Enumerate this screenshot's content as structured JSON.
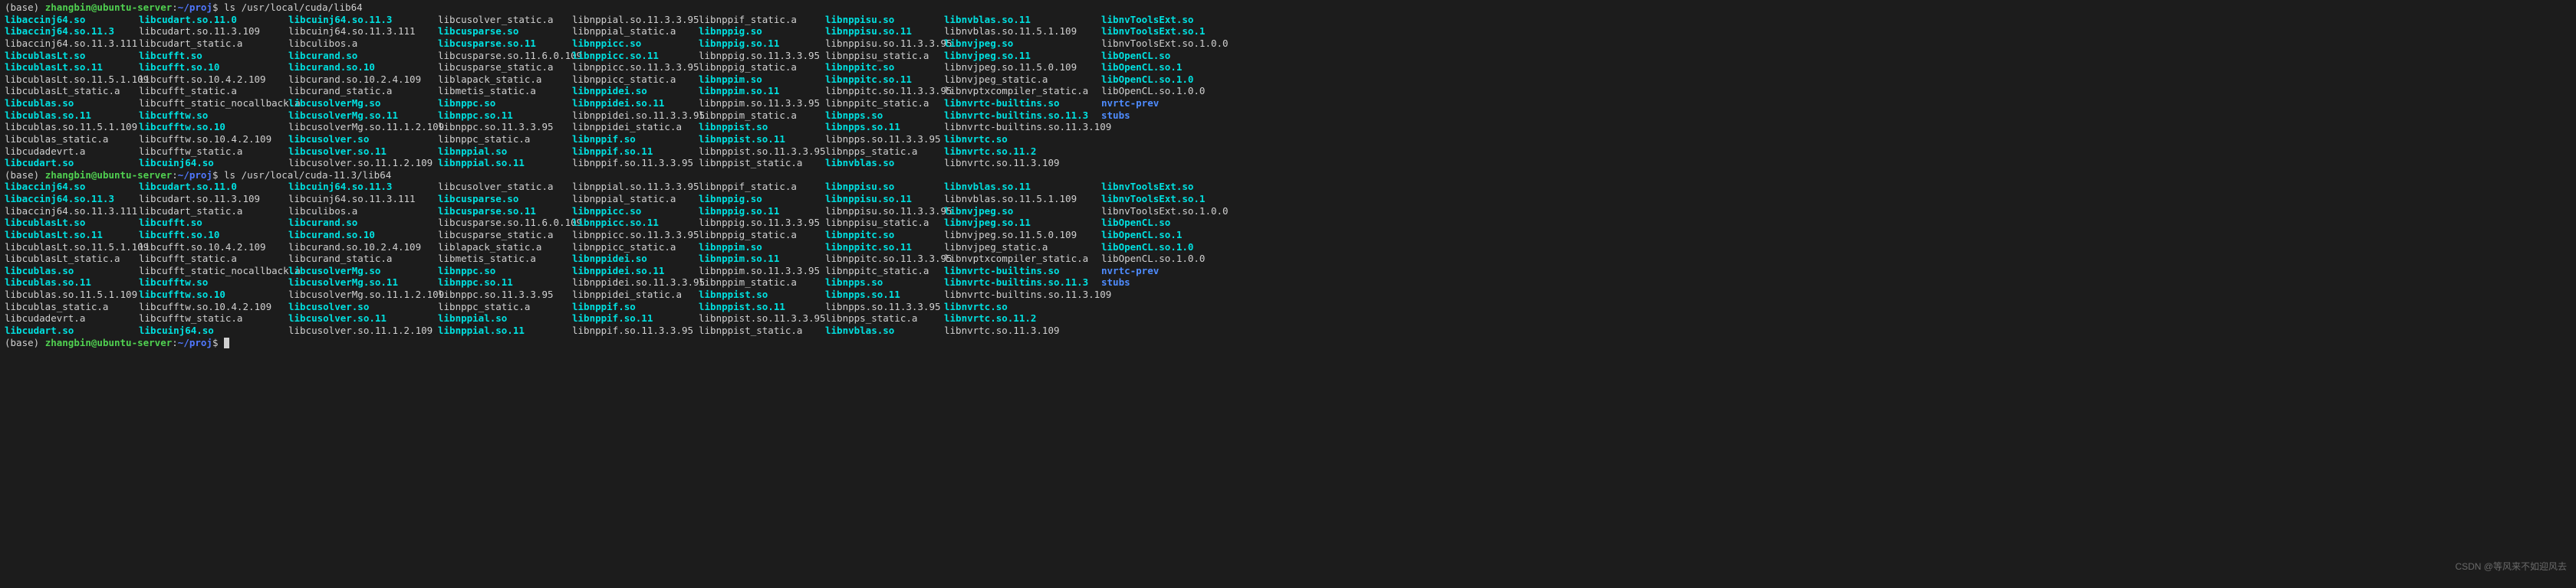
{
  "prompt": {
    "env": "(base)",
    "user_host": "zhangbin@ubuntu-server",
    "sep1": ":",
    "path": "~/proj",
    "sep2": "$ "
  },
  "cmd1": "ls /usr/local/cuda/lib64",
  "cmd2": "ls /usr/local/cuda-11.3/lib64",
  "listing": {
    "cols": [
      [
        {
          "n": "libaccinj64.so",
          "t": "link"
        },
        {
          "n": "libaccinj64.so.11.3",
          "t": "link"
        },
        {
          "n": "libaccinj64.so.11.3.111",
          "t": "reg"
        },
        {
          "n": "libcublasLt.so",
          "t": "link"
        },
        {
          "n": "libcublasLt.so.11",
          "t": "link"
        },
        {
          "n": "libcublasLt.so.11.5.1.109",
          "t": "reg"
        },
        {
          "n": "libcublasLt_static.a",
          "t": "reg"
        },
        {
          "n": "libcublas.so",
          "t": "link"
        },
        {
          "n": "libcublas.so.11",
          "t": "link"
        },
        {
          "n": "libcublas.so.11.5.1.109",
          "t": "reg"
        },
        {
          "n": "libcublas_static.a",
          "t": "reg"
        },
        {
          "n": "libcudadevrt.a",
          "t": "reg"
        },
        {
          "n": "libcudart.so",
          "t": "link"
        }
      ],
      [
        {
          "n": "libcudart.so.11.0",
          "t": "link"
        },
        {
          "n": "libcudart.so.11.3.109",
          "t": "reg"
        },
        {
          "n": "libcudart_static.a",
          "t": "reg"
        },
        {
          "n": "libcufft.so",
          "t": "link"
        },
        {
          "n": "libcufft.so.10",
          "t": "link"
        },
        {
          "n": "libcufft.so.10.4.2.109",
          "t": "reg"
        },
        {
          "n": "libcufft_static.a",
          "t": "reg"
        },
        {
          "n": "libcufft_static_nocallback.a",
          "t": "reg"
        },
        {
          "n": "libcufftw.so",
          "t": "link"
        },
        {
          "n": "libcufftw.so.10",
          "t": "link"
        },
        {
          "n": "libcufftw.so.10.4.2.109",
          "t": "reg"
        },
        {
          "n": "libcufftw_static.a",
          "t": "reg"
        },
        {
          "n": "libcuinj64.so",
          "t": "link"
        }
      ],
      [
        {
          "n": "libcuinj64.so.11.3",
          "t": "link"
        },
        {
          "n": "libcuinj64.so.11.3.111",
          "t": "reg"
        },
        {
          "n": "libculibos.a",
          "t": "reg"
        },
        {
          "n": "libcurand.so",
          "t": "link"
        },
        {
          "n": "libcurand.so.10",
          "t": "link"
        },
        {
          "n": "libcurand.so.10.2.4.109",
          "t": "reg"
        },
        {
          "n": "libcurand_static.a",
          "t": "reg"
        },
        {
          "n": "libcusolverMg.so",
          "t": "link"
        },
        {
          "n": "libcusolverMg.so.11",
          "t": "link"
        },
        {
          "n": "libcusolverMg.so.11.1.2.109",
          "t": "reg"
        },
        {
          "n": "libcusolver.so",
          "t": "link"
        },
        {
          "n": "libcusolver.so.11",
          "t": "link"
        },
        {
          "n": "libcusolver.so.11.1.2.109",
          "t": "reg"
        }
      ],
      [
        {
          "n": "libcusolver_static.a",
          "t": "reg"
        },
        {
          "n": "libcusparse.so",
          "t": "link"
        },
        {
          "n": "libcusparse.so.11",
          "t": "link"
        },
        {
          "n": "libcusparse.so.11.6.0.109",
          "t": "reg"
        },
        {
          "n": "libcusparse_static.a",
          "t": "reg"
        },
        {
          "n": "liblapack_static.a",
          "t": "reg"
        },
        {
          "n": "libmetis_static.a",
          "t": "reg"
        },
        {
          "n": "libnppc.so",
          "t": "link"
        },
        {
          "n": "libnppc.so.11",
          "t": "link"
        },
        {
          "n": "libnppc.so.11.3.3.95",
          "t": "reg"
        },
        {
          "n": "libnppc_static.a",
          "t": "reg"
        },
        {
          "n": "libnppial.so",
          "t": "link"
        },
        {
          "n": "libnppial.so.11",
          "t": "link"
        }
      ],
      [
        {
          "n": "libnppial.so.11.3.3.95",
          "t": "reg"
        },
        {
          "n": "libnppial_static.a",
          "t": "reg"
        },
        {
          "n": "libnppicc.so",
          "t": "link"
        },
        {
          "n": "libnppicc.so.11",
          "t": "link"
        },
        {
          "n": "libnppicc.so.11.3.3.95",
          "t": "reg"
        },
        {
          "n": "libnppicc_static.a",
          "t": "reg"
        },
        {
          "n": "libnppidei.so",
          "t": "link"
        },
        {
          "n": "libnppidei.so.11",
          "t": "link"
        },
        {
          "n": "libnppidei.so.11.3.3.95",
          "t": "reg"
        },
        {
          "n": "libnppidei_static.a",
          "t": "reg"
        },
        {
          "n": "libnppif.so",
          "t": "link"
        },
        {
          "n": "libnppif.so.11",
          "t": "link"
        },
        {
          "n": "libnppif.so.11.3.3.95",
          "t": "reg"
        }
      ],
      [
        {
          "n": "libnppif_static.a",
          "t": "reg"
        },
        {
          "n": "libnppig.so",
          "t": "link"
        },
        {
          "n": "libnppig.so.11",
          "t": "link"
        },
        {
          "n": "libnppig.so.11.3.3.95",
          "t": "reg"
        },
        {
          "n": "libnppig_static.a",
          "t": "reg"
        },
        {
          "n": "libnppim.so",
          "t": "link"
        },
        {
          "n": "libnppim.so.11",
          "t": "link"
        },
        {
          "n": "libnppim.so.11.3.3.95",
          "t": "reg"
        },
        {
          "n": "libnppim_static.a",
          "t": "reg"
        },
        {
          "n": "libnppist.so",
          "t": "link"
        },
        {
          "n": "libnppist.so.11",
          "t": "link"
        },
        {
          "n": "libnppist.so.11.3.3.95",
          "t": "reg"
        },
        {
          "n": "libnppist_static.a",
          "t": "reg"
        }
      ],
      [
        {
          "n": "libnppisu.so",
          "t": "link"
        },
        {
          "n": "libnppisu.so.11",
          "t": "link"
        },
        {
          "n": "libnppisu.so.11.3.3.95",
          "t": "reg"
        },
        {
          "n": "libnppisu_static.a",
          "t": "reg"
        },
        {
          "n": "libnppitc.so",
          "t": "link"
        },
        {
          "n": "libnppitc.so.11",
          "t": "link"
        },
        {
          "n": "libnppitc.so.11.3.3.95",
          "t": "reg"
        },
        {
          "n": "libnppitc_static.a",
          "t": "reg"
        },
        {
          "n": "libnpps.so",
          "t": "link"
        },
        {
          "n": "libnpps.so.11",
          "t": "link"
        },
        {
          "n": "libnpps.so.11.3.3.95",
          "t": "reg"
        },
        {
          "n": "libnpps_static.a",
          "t": "reg"
        },
        {
          "n": "libnvblas.so",
          "t": "link"
        }
      ],
      [
        {
          "n": "libnvblas.so.11",
          "t": "link"
        },
        {
          "n": "libnvblas.so.11.5.1.109",
          "t": "reg"
        },
        {
          "n": "libnvjpeg.so",
          "t": "link"
        },
        {
          "n": "libnvjpeg.so.11",
          "t": "link"
        },
        {
          "n": "libnvjpeg.so.11.5.0.109",
          "t": "reg"
        },
        {
          "n": "libnvjpeg_static.a",
          "t": "reg"
        },
        {
          "n": "libnvptxcompiler_static.a",
          "t": "reg"
        },
        {
          "n": "libnvrtc-builtins.so",
          "t": "link"
        },
        {
          "n": "libnvrtc-builtins.so.11.3",
          "t": "link"
        },
        {
          "n": "libnvrtc-builtins.so.11.3.109",
          "t": "reg"
        },
        {
          "n": "libnvrtc.so",
          "t": "link"
        },
        {
          "n": "libnvrtc.so.11.2",
          "t": "link"
        },
        {
          "n": "libnvrtc.so.11.3.109",
          "t": "reg"
        }
      ],
      [
        {
          "n": "libnvToolsExt.so",
          "t": "link"
        },
        {
          "n": "libnvToolsExt.so.1",
          "t": "link"
        },
        {
          "n": "libnvToolsExt.so.1.0.0",
          "t": "reg"
        },
        {
          "n": "libOpenCL.so",
          "t": "link"
        },
        {
          "n": "libOpenCL.so.1",
          "t": "link"
        },
        {
          "n": "libOpenCL.so.1.0",
          "t": "link"
        },
        {
          "n": "libOpenCL.so.1.0.0",
          "t": "reg"
        },
        {
          "n": "nvrtc-prev",
          "t": "dir"
        },
        {
          "n": "stubs",
          "t": "dir"
        }
      ]
    ]
  },
  "watermark": "CSDN @等风来不如迎风去"
}
